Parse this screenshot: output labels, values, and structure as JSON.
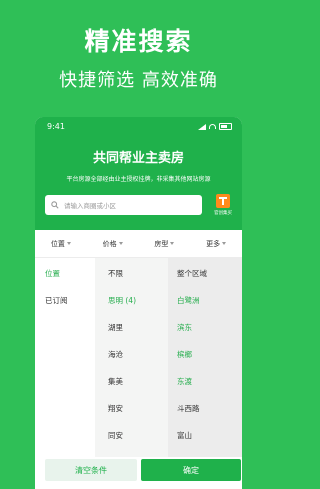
{
  "hero": {
    "title": "精准搜索",
    "subtitle": "快捷筛选  高效准确"
  },
  "status": {
    "time": "9:41"
  },
  "app": {
    "title": "共同帮业主卖房",
    "desc": "平台房源全部经由业主授权挂牌，非采集其他网站房源",
    "search_placeholder": "请输入商圈或小区",
    "quick_label": "官创集买"
  },
  "filters": [
    "位置",
    "价格",
    "房型",
    "更多"
  ],
  "col1": [
    "位置",
    "已订阅"
  ],
  "col2": [
    "不限",
    "思明 (4)",
    "湖里",
    "海沧",
    "集美",
    "翔安",
    "同安"
  ],
  "col3": [
    "整个区域",
    "白鹭洲",
    "滨东",
    "槟榔",
    "东渡",
    "斗西路",
    "富山"
  ],
  "buttons": {
    "clear": "清空条件",
    "ok": "确定"
  },
  "colors": {
    "primary": "#1fb14b",
    "background": "#2fbf57"
  }
}
